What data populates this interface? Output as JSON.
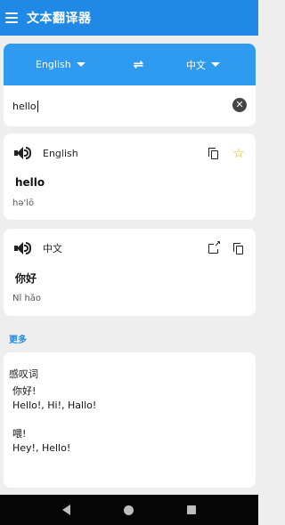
{
  "appbar": {
    "title": "文本翻译器",
    "menu_icon": "menu-icon"
  },
  "languages": {
    "source": "English",
    "target": "中文",
    "swap_icon": "swap-icon",
    "swap_glyph": "⇌"
  },
  "input": {
    "value": "hello",
    "clear_icon": "clear-icon",
    "clear_glyph": "✕"
  },
  "source_card": {
    "language": "English",
    "word": "hello",
    "phonetic": "hə'lō",
    "icons": [
      "speaker-icon",
      "copy-icon",
      "star-icon"
    ],
    "star_glyph": "☆"
  },
  "target_card": {
    "language": "中文",
    "word": "你好",
    "phonetic": "Nǐ hǎo",
    "icons": [
      "speaker-icon",
      "share-icon",
      "copy-icon"
    ],
    "share_glyph": "↗"
  },
  "more": {
    "label": "更多"
  },
  "dictionary": {
    "part_of_speech": "感叹词",
    "entries": [
      {
        "word": "你好!",
        "translations": "Hello!,  Hi!,  Hallo!"
      },
      {
        "word": "喂!",
        "translations": "Hey!,  Hello!"
      }
    ]
  },
  "colors": {
    "primary": "#2089e6",
    "lang_bar": "#2e9af0",
    "star": "#f0b400",
    "navbar": "#050505"
  },
  "navbar": {
    "icons": [
      "back-icon",
      "home-icon",
      "recents-icon"
    ]
  }
}
